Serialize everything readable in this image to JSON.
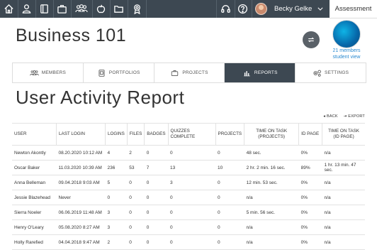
{
  "topbar": {
    "nav_icons": [
      "home-icon",
      "person-icon",
      "book-icon",
      "briefcase-icon",
      "group-icon",
      "apple-icon",
      "folder-icon",
      "award-icon"
    ],
    "help_icons": [
      "headset-icon",
      "question-icon"
    ],
    "user_name": "Becky Gelke",
    "assessment_label": "Assessment",
    "bg_color": "#3d4852"
  },
  "header": {
    "title": "Business 101",
    "members_line1": "21 members",
    "members_line2": "student view"
  },
  "tabs": [
    {
      "label": "MEMBERS",
      "icon": "group-icon"
    },
    {
      "label": "PORTFOLIOS",
      "icon": "portfolio-icon"
    },
    {
      "label": "PROJECTS",
      "icon": "briefcase-icon"
    },
    {
      "label": "REPORTS",
      "icon": "bar-chart-icon",
      "active": true
    },
    {
      "label": "SETTINGS",
      "icon": "gears-icon"
    }
  ],
  "report": {
    "title": "User Activity Report",
    "back_label": "BACK",
    "export_label": "EXPORT",
    "columns": [
      "USER",
      "LAST LOGIN",
      "LOGINS",
      "FILES",
      "BADGES",
      "QUIZZES COMPLETE",
      "PROJECTS",
      "TIME ON TASK (PROJECTS)",
      "ID PAGE",
      "TIME ON TASK (ID PAGE)"
    ],
    "rows": [
      [
        "Newton Akontly",
        "08.20.2020 10:12 AM",
        "4",
        "2",
        "0",
        "0",
        "0",
        "48 sec.",
        "0%",
        "n/a"
      ],
      [
        "Oscar Baker",
        "11.03.2020 10:39 AM",
        "236",
        "53",
        "7",
        "13",
        "10",
        "2 hr. 2 min. 16 sec.",
        "89%",
        "1 hr. 13 min. 47 sec."
      ],
      [
        "Anna Belleman",
        "09.04.2018 9:03 AM",
        "5",
        "0",
        "0",
        "3",
        "0",
        "12 min. 53 sec.",
        "0%",
        "n/a"
      ],
      [
        "Jessie Blazehead",
        "Never",
        "0",
        "0",
        "0",
        "0",
        "0",
        "n/a",
        "0%",
        "n/a"
      ],
      [
        "Sierra Noeler",
        "06.06.2019 11:48 AM",
        "3",
        "0",
        "0",
        "0",
        "0",
        "5 min. 56 sec.",
        "0%",
        "n/a"
      ],
      [
        "Henry O'Leary",
        "05.08.2020 8:27 AM",
        "3",
        "0",
        "0",
        "0",
        "0",
        "n/a",
        "0%",
        "n/a"
      ],
      [
        "Holly Rarefied",
        "04.04.2018 9:47 AM",
        "2",
        "0",
        "0",
        "0",
        "0",
        "n/a",
        "0%",
        "n/a"
      ]
    ]
  }
}
